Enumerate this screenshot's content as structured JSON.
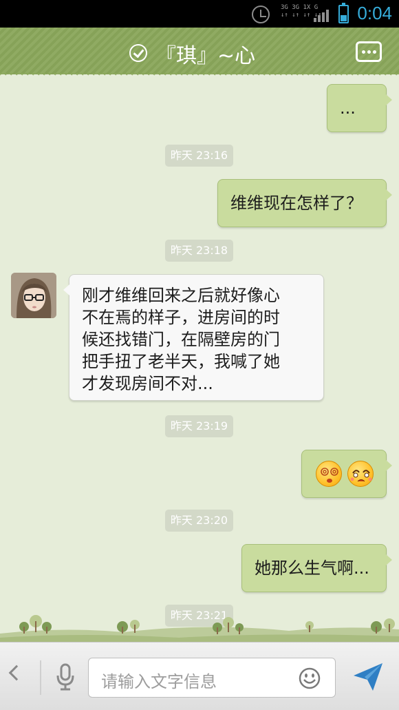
{
  "status_bar": {
    "time": "0:04",
    "network_top": "3G 3G 1X G",
    "network_bottom": "↓↑ ↓↑ ↓↑ ↓↑",
    "icons": [
      "alarm-icon",
      "signal-icon",
      "battery-icon"
    ]
  },
  "header": {
    "title": "『琪』~心",
    "check_icon": "check-circle-icon",
    "menu_icon": "more-dots-icon"
  },
  "conversation": {
    "messages": [
      {
        "type": "out",
        "text": "..."
      },
      {
        "type": "time",
        "text": "昨天 23:16"
      },
      {
        "type": "out",
        "text": "维维现在怎样了？"
      },
      {
        "type": "time",
        "text": "昨天 23:18"
      },
      {
        "type": "in",
        "lines": [
          "刚才维维回来之后就好像心",
          "不在焉的样子，进房间的时",
          "候还找错门，在隔壁房的门",
          "把手扭了老半天，我喊了她",
          "才发现房间不对..."
        ]
      },
      {
        "type": "time",
        "text": "昨天 23:19"
      },
      {
        "type": "out_emoji",
        "emojis": [
          "dizzy-face-emoji",
          "teary-face-emoji"
        ]
      },
      {
        "type": "time",
        "text": "昨天 23:20"
      },
      {
        "type": "out",
        "text": "她那么生气啊..."
      },
      {
        "type": "time",
        "text": "昨天 23:21"
      }
    ]
  },
  "input_bar": {
    "placeholder": "请输入文字信息",
    "back_icon": "chevron-left-icon",
    "voice_icon": "microphone-icon",
    "emoji_icon": "smiley-icon",
    "send_icon": "send-arrow-icon"
  },
  "colors": {
    "header_green": "#8aa75b",
    "outgoing_bubble": "#c9dc9e",
    "incoming_bubble": "#f8f8f8",
    "background": "#e6edd9",
    "time_accent": "#36acd9"
  }
}
